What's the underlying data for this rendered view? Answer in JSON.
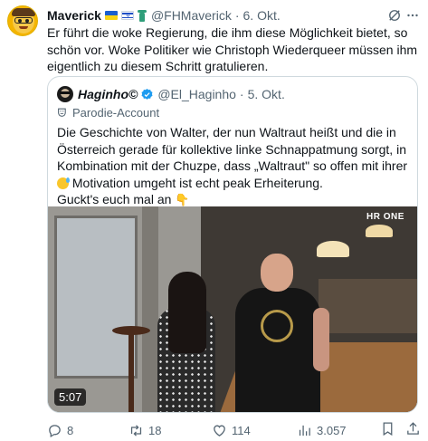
{
  "tweet": {
    "author_name": "Maverick",
    "author_handle": "@FHMaverick",
    "separator": "·",
    "date": "6. Okt.",
    "text": "Er führt die woke Regierung, die ihm diese Möglichkeit bietet, so schön vor. Woke Politiker wie Christoph Wiederqueer müssen ihm eigentlich zu diesem Schritt gratulieren.",
    "badges": [
      "ukraine-flag-icon",
      "israel-flag-icon",
      "statue-of-liberty-icon"
    ]
  },
  "quote": {
    "author_name": "Haginho©",
    "author_handle": "@El_Haginho",
    "separator": "·",
    "date": "5. Okt.",
    "parody_label": "Parodie-Account",
    "text_part1": "Die Geschichte von Walter, der nun Waltraut heißt und die in Österreich gerade für kollektive linke Schnappatmung sorgt, in Kombination mit der Chuzpe, dass „Waltraut\" so offen mit ihrer ",
    "text_part2": " Motivation umgeht ist echt peak Erheiterung.",
    "text_line2": "Guckt's euch mal an ",
    "video": {
      "duration": "5:07",
      "overlay_logo": "HR ONE"
    }
  },
  "actions": {
    "replies": "8",
    "retweets": "18",
    "likes": "114",
    "views": "3.057"
  },
  "colors": {
    "text": "#0f1419",
    "secondary": "#536471",
    "border": "#cfd9de",
    "verified": "#1d9bf0"
  }
}
